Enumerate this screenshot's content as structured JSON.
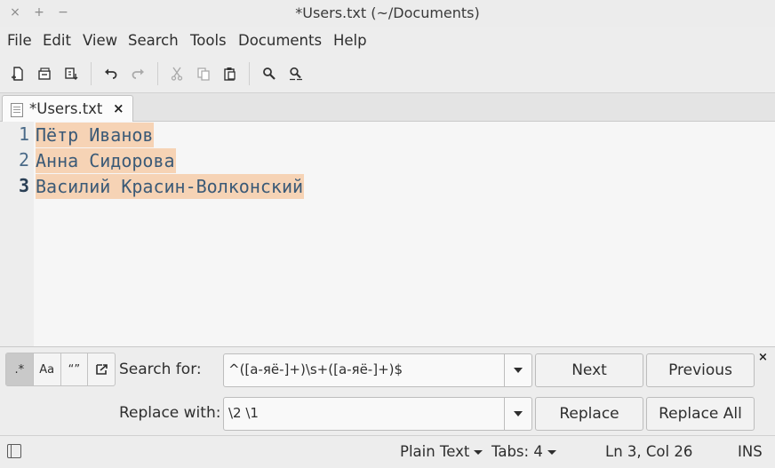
{
  "window": {
    "title": "*Users.txt (~/Documents)",
    "controls": [
      "×",
      "+",
      "−"
    ]
  },
  "menu": [
    "File",
    "Edit",
    "View",
    "Search",
    "Tools",
    "Documents",
    "Help"
  ],
  "tab": {
    "label": "*Users.txt",
    "close": "×"
  },
  "editor": {
    "lines": [
      {
        "number": "1",
        "text": "Пётр Иванов"
      },
      {
        "number": "2",
        "text": "Анна Сидорова"
      },
      {
        "number": "3",
        "text": "Василий Красин-Волконский"
      }
    ]
  },
  "search": {
    "options": [
      ".*",
      "Aa",
      "“”"
    ],
    "search_label": "Search for:",
    "search_value": "^([а-яё-]+)\\s+([а-яё-]+)$",
    "replace_label": "Replace with:",
    "replace_value": "\\2 \\1",
    "next": "Next",
    "previous": "Previous",
    "replace": "Replace",
    "replace_all": "Replace All",
    "close": "×"
  },
  "status": {
    "language": "Plain Text",
    "tabs": "Tabs: 4",
    "position": "Ln 3, Col 26",
    "mode": "INS"
  }
}
